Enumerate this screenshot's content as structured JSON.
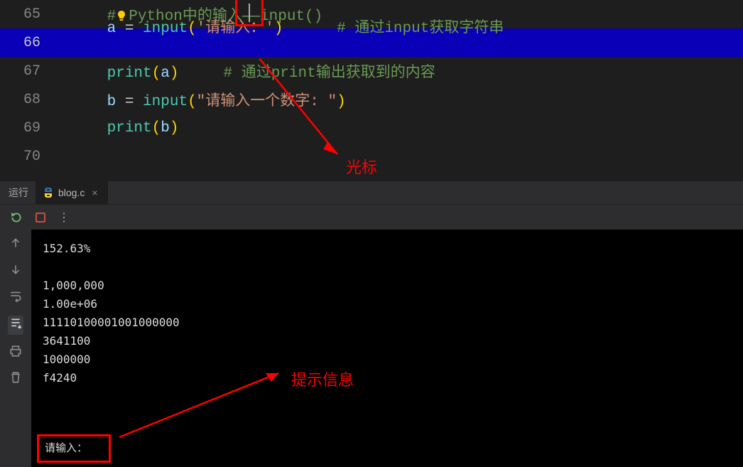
{
  "editor": {
    "lines": [
      {
        "num": "65",
        "comment_head": "#",
        "comment_body": "Python中的输入——input()"
      },
      {
        "num": "66",
        "var": "a",
        "op": " = ",
        "fn": "input",
        "lp": "(",
        "str": "'请输入：'",
        "rp": ")",
        "pad": "      ",
        "c": "# 通过input获取字符串"
      },
      {
        "num": "67",
        "fn": "print",
        "lp": "(",
        "var": "a",
        "rp": ")",
        "pad": "     ",
        "c": "# 通过print输出获取到的内容"
      },
      {
        "num": "68",
        "var": "b",
        "op": " = ",
        "fn": "input",
        "lp": "(",
        "str": "\"请输入一个数字: \"",
        "rp": ")"
      },
      {
        "num": "69",
        "fn": "print",
        "lp": "(",
        "var": "b",
        "rp": ")"
      },
      {
        "num": "70"
      }
    ]
  },
  "run": {
    "title": "运行",
    "tab_name": "blog.c",
    "tab_close": "×"
  },
  "console": {
    "out": [
      "152.63%",
      "",
      "1,000,000",
      "1.00e+06",
      "11110100001001000000",
      "3641100",
      "1000000",
      "f4240"
    ],
    "prompt": "请输入："
  },
  "annotations": {
    "cursor_label": "光标",
    "prompt_label": "提示信息"
  }
}
